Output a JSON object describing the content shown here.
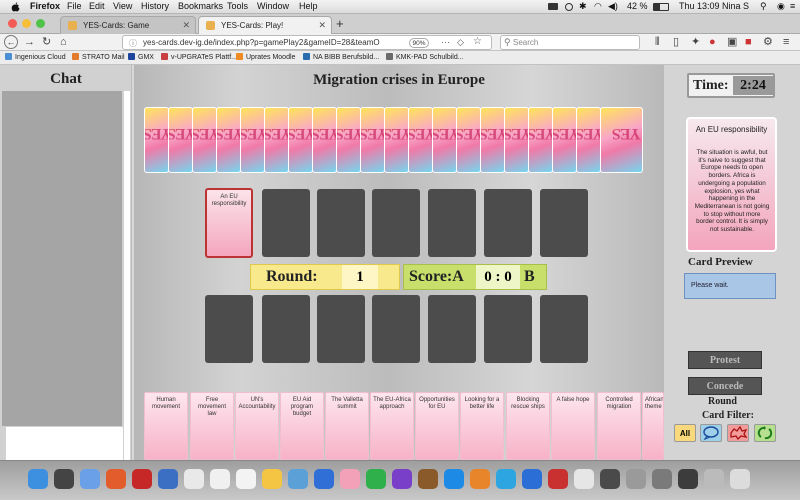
{
  "menubar": {
    "app": "Firefox",
    "menus": [
      "File",
      "Edit",
      "View",
      "History",
      "Bookmarks",
      "Tools",
      "Window",
      "Help"
    ],
    "battery": "42 %",
    "clock": "Thu 13:09",
    "user": "Nina S"
  },
  "tabs": [
    {
      "label": "YES-Cards: Game",
      "active": false
    },
    {
      "label": "YES-Cards: Play!",
      "active": true
    }
  ],
  "navbar": {
    "url": "yes-cards.dev-ig.de/index.php?p=gamePlay2&gameID=28&teamO",
    "zoom": "90%",
    "search_placeholder": "Search"
  },
  "bookmarks": [
    "Ingenious Cloud",
    "STRATO Mail",
    "GMX",
    "v-UPGRATeS Plattf...",
    "Uprates Moodle",
    "NA BIBB Berufsbild...",
    "KMK-PAD Schulbild..."
  ],
  "chat": {
    "title": "Chat"
  },
  "game": {
    "title": "Migration crises in Europe",
    "deck_back_text": "YES",
    "played_card": "An EU responsibility",
    "round_label": "Round:",
    "round_value": "1",
    "score_label": "Score:A",
    "score_value": "0 : 0",
    "score_b": "B",
    "hand": [
      "Human movement",
      "Free movement law",
      "UN's Accountability",
      "EU Aid program budget",
      "The Valletta summit",
      "The EU-Africa approach",
      "Opportunities for EU",
      "Looking for a better life",
      "Blocking rescue ships",
      "A false hope",
      "Controlled migration",
      "African theme"
    ]
  },
  "sidebar": {
    "time_label": "Time:",
    "time_value": "2:24",
    "preview_title": "An EU responsibility",
    "preview_body": "The situation is awful, but it's naive to suggest that Europe needs to open borders. Africa is undergoing a population explosion, yes what happening in the Mediterranean is not going to stop without more border control. It is simply not sustainable.",
    "preview_label": "Card Preview",
    "status": "Please wait.",
    "protest": "Protest",
    "concede": "Concede",
    "round_label": "Round",
    "filter_label": "Card Filter:",
    "filter_all": "All"
  },
  "colors": {
    "accent_yellow": "#f8ea8c",
    "accent_green": "#c8e06b",
    "card_pink": "#f4a6bf",
    "status_blue": "#a9c6e6"
  }
}
